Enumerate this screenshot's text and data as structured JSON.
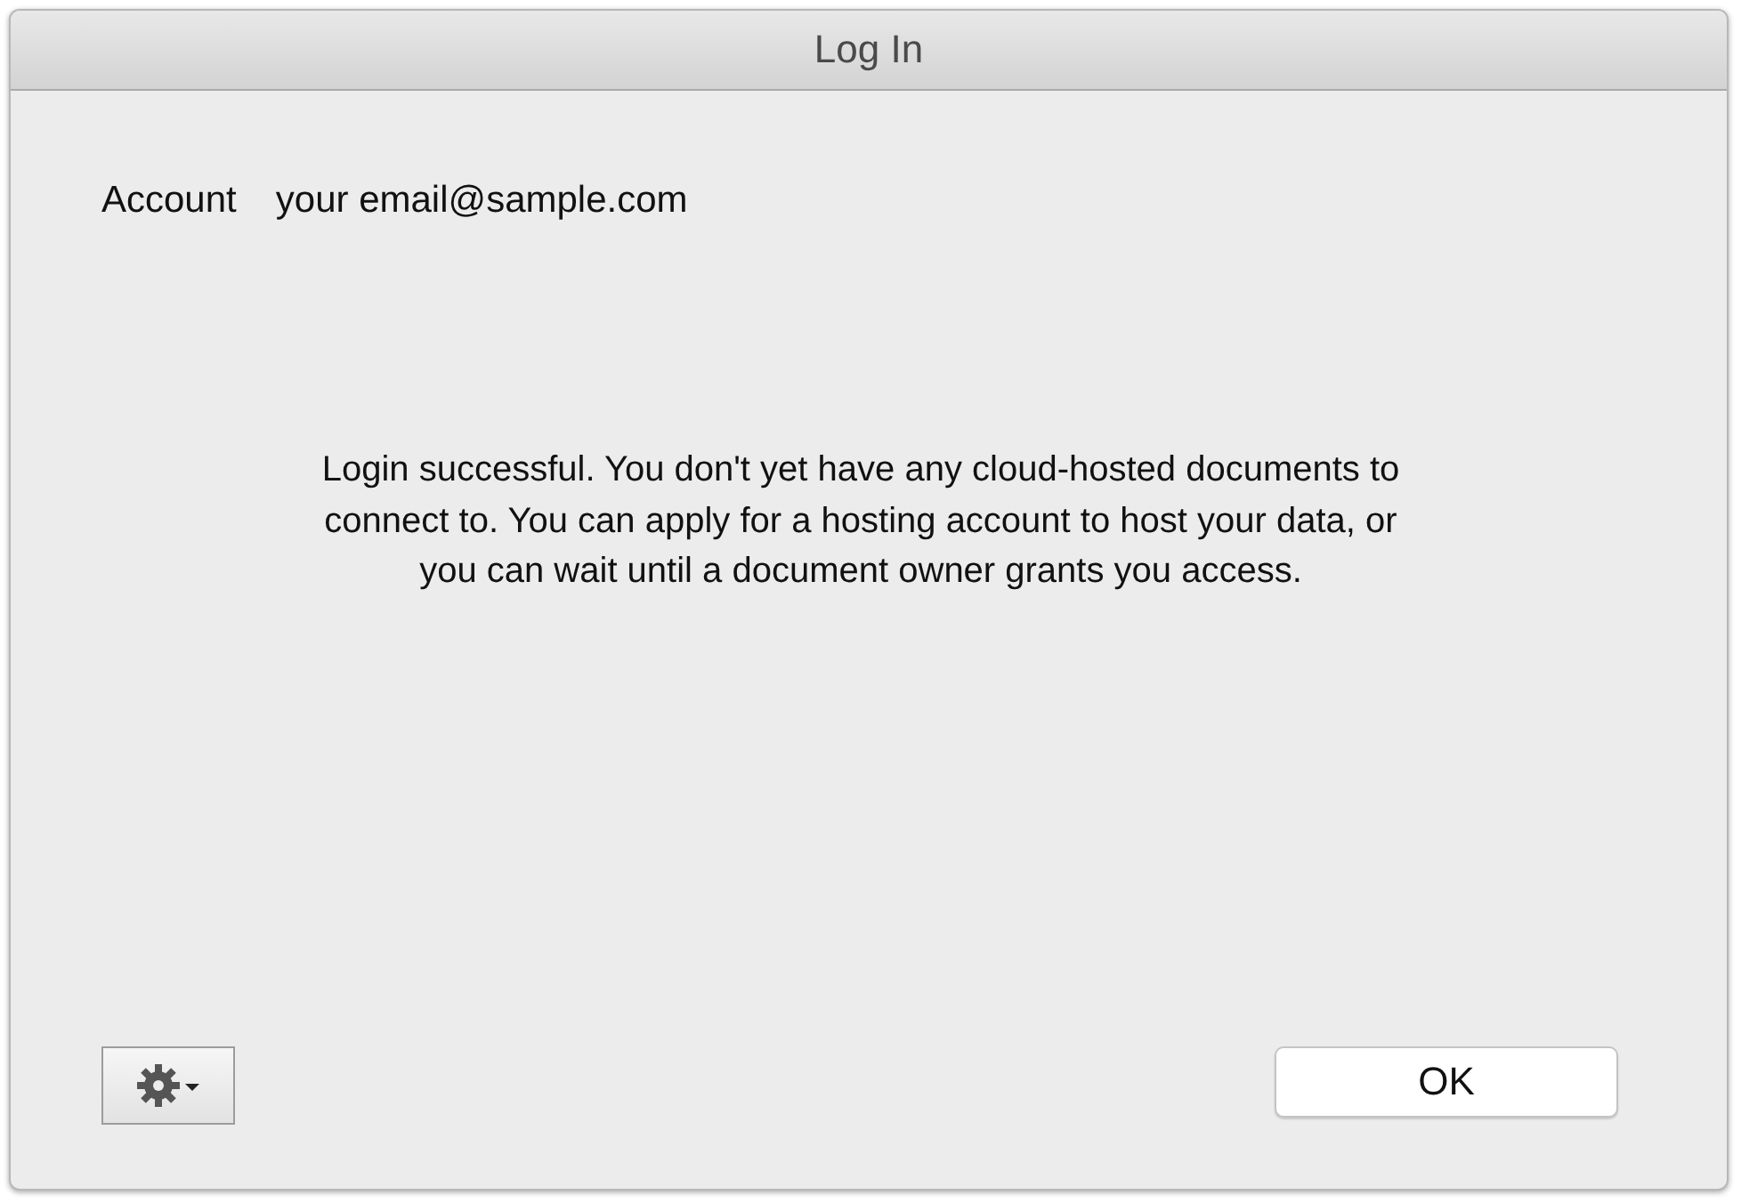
{
  "window": {
    "title": "Log In"
  },
  "account": {
    "label": "Account",
    "value": "your email@sample.com"
  },
  "message": "Login successful. You don't yet have any cloud-hosted documents to connect to. You can apply for a hosting account to host your data, or you can wait until a document owner grants you access.",
  "buttons": {
    "ok": "OK"
  }
}
